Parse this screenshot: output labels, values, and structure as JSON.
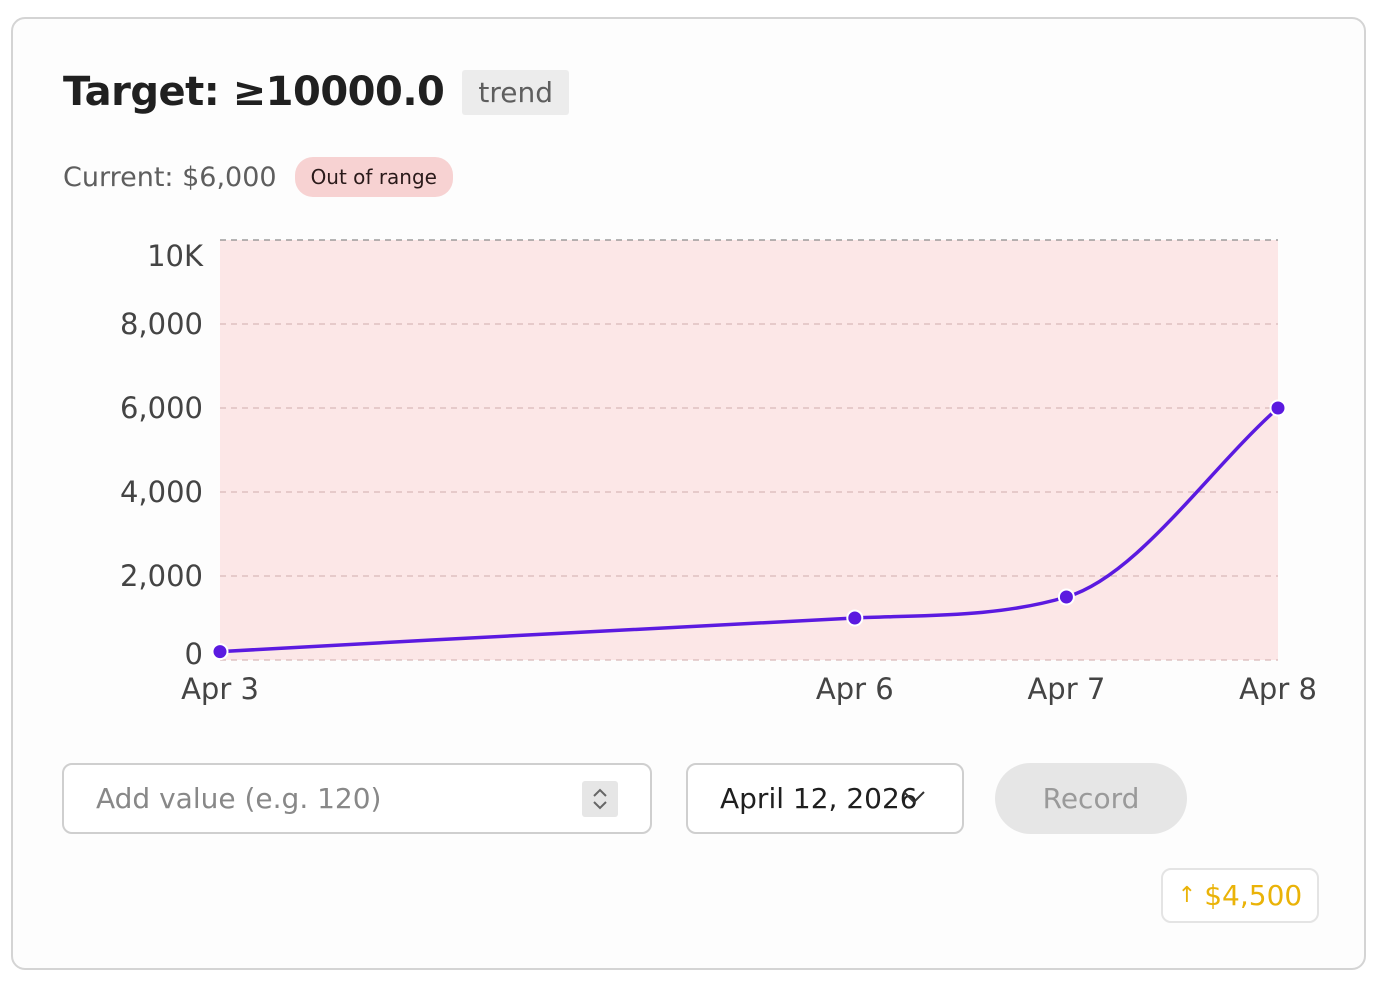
{
  "header": {
    "title": "Target: ≥10000.0",
    "tag": "trend",
    "current": "Current: $6,000",
    "status_badge": "Out of range"
  },
  "colors": {
    "line": "#5b1ae0",
    "band": "#fce7e7",
    "badge_bg": "#f7d2d2",
    "delta": "#eab308"
  },
  "chart_data": {
    "type": "line",
    "x": [
      "2026-04-03",
      "2026-04-06",
      "2026-04-07",
      "2026-04-08"
    ],
    "x_tick_labels": [
      "Apr 3",
      "Apr 6",
      "Apr 7",
      "Apr 8"
    ],
    "values": [
      200,
      1000,
      1500,
      6000
    ],
    "ylim": [
      0,
      10000
    ],
    "y_ticks": [
      0,
      2000,
      4000,
      6000,
      8000,
      10000
    ],
    "y_tick_labels": [
      "0",
      "2,000",
      "4,000",
      "6,000",
      "8,000",
      "10K"
    ],
    "target_min": 10000,
    "shaded_region": "out-of-range",
    "grid": true,
    "curve": "smooth"
  },
  "form": {
    "value_placeholder": "Add value (e.g. 120)",
    "date_value": "April 12, 2026",
    "record_label": "Record"
  },
  "delta": {
    "arrow": "↑",
    "value": "$4,500"
  }
}
